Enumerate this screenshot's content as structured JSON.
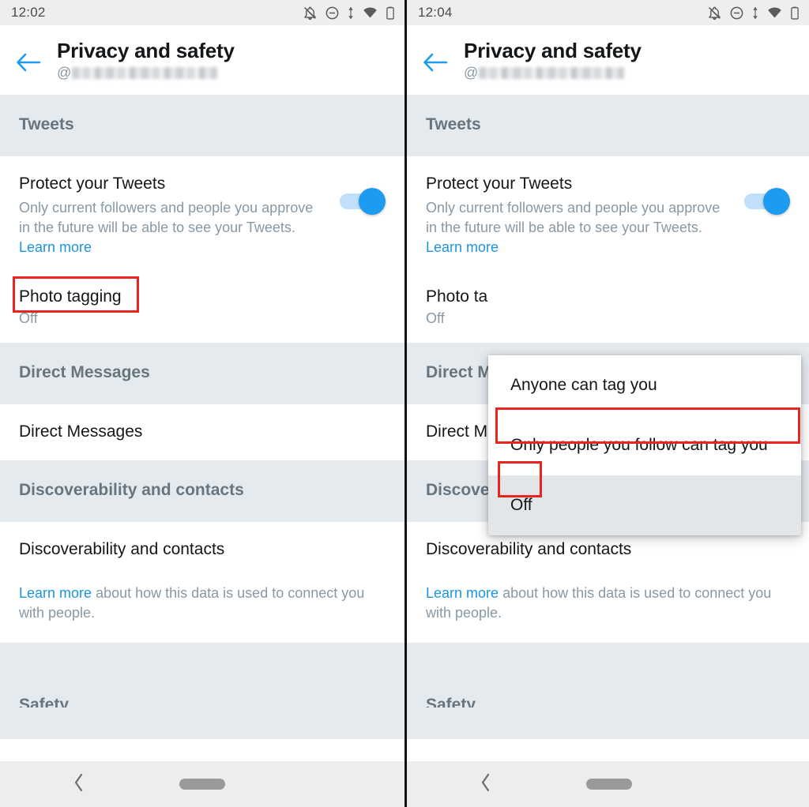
{
  "left": {
    "status": {
      "time": "12:02"
    },
    "appbar": {
      "title": "Privacy and safety",
      "handle_prefix": "@",
      "back_icon": "arrow-left-icon"
    },
    "sections": {
      "tweets": "Tweets",
      "direct_messages": "Direct Messages",
      "discoverability": "Discoverability and contacts",
      "safety": "Safety"
    },
    "protect": {
      "title": "Protect your Tweets",
      "desc": "Only current followers and people you approve in the future will be able to see your Tweets. ",
      "link": "Learn more",
      "toggle_state": "on"
    },
    "photo_tagging": {
      "title": "Photo tagging",
      "value": "Off"
    },
    "direct_messages_row": "Direct Messages",
    "discoverability_row": "Discoverability and contacts",
    "footer": {
      "link": "Learn more",
      "text": " about how this data is used to connect you with people."
    }
  },
  "right": {
    "status": {
      "time": "12:04"
    },
    "appbar": {
      "title": "Privacy and safety",
      "handle_prefix": "@",
      "back_icon": "arrow-left-icon"
    },
    "sections": {
      "tweets": "Tweets",
      "direct_messages": "Direct Messages",
      "discoverability": "Discoverability and contacts",
      "safety": "Safety"
    },
    "protect": {
      "title": "Protect your Tweets",
      "desc": "Only current followers and people you approve in the future will be able to see your Tweets. ",
      "link": "Learn more",
      "toggle_state": "on"
    },
    "photo_tagging": {
      "title": "Photo ta",
      "value": "Off"
    },
    "direct_messages_row": "Direct Messages",
    "discoverability_row": "Discoverability and contacts",
    "footer": {
      "link": "Learn more",
      "text": " about how this data is used to connect you with people."
    },
    "dropdown": {
      "options": [
        "Anyone can tag you",
        "Only people you follow can tag you",
        "Off"
      ],
      "selected_index": 2
    }
  },
  "navbar": {
    "back_icon": "chevron-left-icon",
    "home_icon": "home-pill-icon"
  },
  "status_icons": [
    "notifications-off-icon",
    "do-not-disturb-icon",
    "data-transfer-icon",
    "wifi-icon",
    "battery-icon"
  ],
  "colors": {
    "accent": "#1d9bf0",
    "link": "#1b95e0",
    "section_bg": "#e5eaee",
    "section_text": "#66757f",
    "annotation": "#e8251f",
    "primary_text": "#14171a",
    "secondary_text": "#8899a6"
  }
}
